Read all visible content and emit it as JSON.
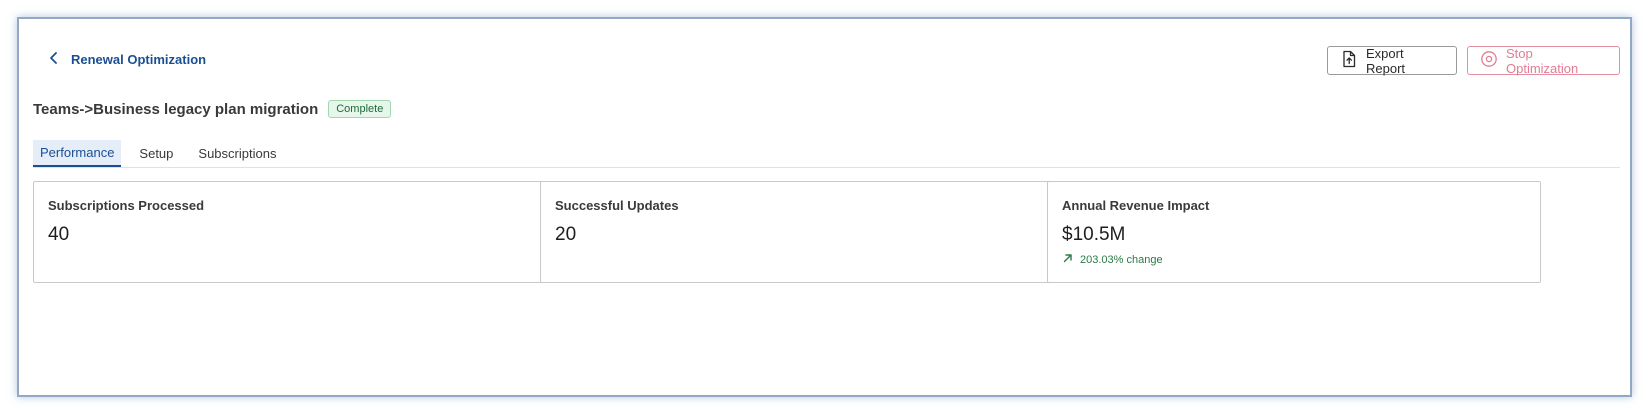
{
  "header": {
    "back_label": "Renewal Optimization",
    "export_label": "Export Report",
    "stop_label": "Stop Optimization"
  },
  "title": {
    "text": "Teams->Business legacy plan migration",
    "status": "Complete"
  },
  "tabs": [
    {
      "label": "Performance",
      "active": true
    },
    {
      "label": "Setup",
      "active": false
    },
    {
      "label": "Subscriptions",
      "active": false
    }
  ],
  "metrics": [
    {
      "label": "Subscriptions Processed",
      "value": "40"
    },
    {
      "label": "Successful Updates",
      "value": "20"
    },
    {
      "label": "Annual Revenue Impact",
      "value": "$10.5M",
      "change": "203.03% change"
    }
  ],
  "colors": {
    "accent": "#1b4f94",
    "danger": "#e27c93",
    "success": "#2a7a45",
    "frame": "#8fa9c6"
  },
  "icons": {
    "back": "chevron-left-icon",
    "export": "file-upload-icon",
    "stop": "stop-circle-icon",
    "change": "arrow-up-right-icon"
  }
}
